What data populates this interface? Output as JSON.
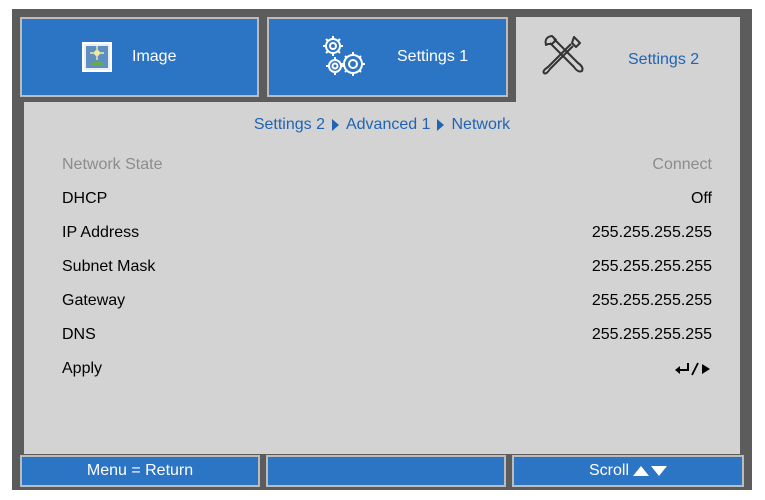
{
  "tabs": [
    {
      "label": "Image",
      "icon": "image-icon",
      "active": false
    },
    {
      "label": "Settings 1",
      "icon": "gears-icon",
      "active": false
    },
    {
      "label": "Settings 2",
      "icon": "tools-icon",
      "active": true
    }
  ],
  "breadcrumb": [
    "Settings 2",
    "Advanced 1",
    "Network"
  ],
  "rows": [
    {
      "label": "Network State",
      "value": "Connect",
      "disabled": true
    },
    {
      "label": "DHCP",
      "value": "Off"
    },
    {
      "label": "IP Address",
      "value": "255.255.255.255"
    },
    {
      "label": "Subnet Mask",
      "value": "255.255.255.255"
    },
    {
      "label": "Gateway",
      "value": "255.255.255.255"
    },
    {
      "label": "DNS",
      "value": "255.255.255.255"
    },
    {
      "label": "Apply",
      "value": "",
      "icon": "enter-arrow-icon"
    }
  ],
  "footer": {
    "left": "Menu = Return",
    "middle": "",
    "right": "Scroll"
  },
  "colors": {
    "tab_blue": "#2c74c4",
    "panel_gray": "#d3d3d3",
    "frame_gray": "#5c5c5c",
    "active_text": "#1f64b4",
    "disabled_text": "#8c8c8c"
  }
}
